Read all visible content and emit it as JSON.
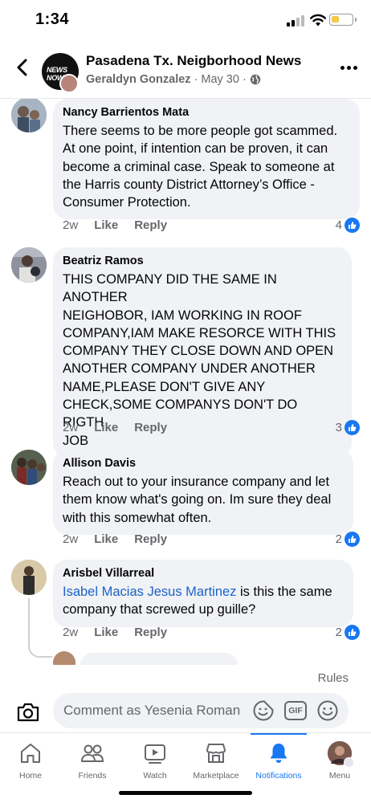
{
  "status_bar": {
    "time": "1:34"
  },
  "header": {
    "title": "Pasadena Tx. Neigborhood News",
    "author": "Geraldyn Gonzalez",
    "date": "May 30",
    "separator": "·",
    "avatar_label": "NEWS NOW"
  },
  "comments": [
    {
      "name": "Nancy Barrientos Mata",
      "lines": [
        "There seems to be more people got scammed.",
        "At one point, if intention can be proven, it can",
        "become a criminal case. Speak to someone at",
        "the Harris county District Attorney’s Office -",
        "Consumer Protection."
      ],
      "age": "2w",
      "like": "Like",
      "reply": "Reply",
      "reactions": "4",
      "avatar_color": "#8a9bb0"
    },
    {
      "name": "Beatriz Ramos",
      "lines": [
        "THIS COMPANY DID THE SAME IN ANOTHER",
        "NEIGHOBOR, IAM WORKING IN ROOF",
        "COMPANY,IAM MAKE RESORCE WITH THIS",
        "COMPANY THEY CLOSE DOWN AND OPEN",
        "ANOTHER COMPANY UNDER ANOTHER",
        "NAME,PLEASE DON'T GIVE ANY",
        "CHECK,SOME COMPANYS DON'T DO RIGTH",
        "JOB"
      ],
      "age": "2w",
      "like": "Like",
      "reply": "Reply",
      "reactions": "3",
      "avatar_color": "#6c6f7a"
    },
    {
      "name": "Allison Davis",
      "lines": [
        "Reach out to your insurance company and let",
        "them know what's going on.  Im sure they deal",
        "with this somewhat often."
      ],
      "age": "2w",
      "like": "Like",
      "reply": "Reply",
      "reactions": "2",
      "avatar_color": "#5b6b55"
    },
    {
      "name": "Arisbel Villarreal",
      "mention": "Isabel Macias Jesus Martinez",
      "text_after_mention": " is this the same",
      "line2": "company that screwed up guille?",
      "age": "2w",
      "like": "Like",
      "reply": "Reply",
      "reactions": "2",
      "avatar_color": "#c9b48e"
    }
  ],
  "rules_link": "Rules",
  "composer": {
    "placeholder": "Comment as Yesenia Roman"
  },
  "tabbar": {
    "tabs": [
      {
        "label": "Home",
        "icon": "home-icon"
      },
      {
        "label": "Friends",
        "icon": "friends-icon"
      },
      {
        "label": "Watch",
        "icon": "watch-icon"
      },
      {
        "label": "Marketplace",
        "icon": "marketplace-icon"
      },
      {
        "label": "Notifications",
        "icon": "bell-icon",
        "active": true
      },
      {
        "label": "Menu",
        "icon": "profile-avatar"
      }
    ]
  },
  "colors": {
    "accent": "#1877f2",
    "mention": "#1b62c8",
    "bubble": "#f0f2f5",
    "secondary_text": "#65676b"
  }
}
